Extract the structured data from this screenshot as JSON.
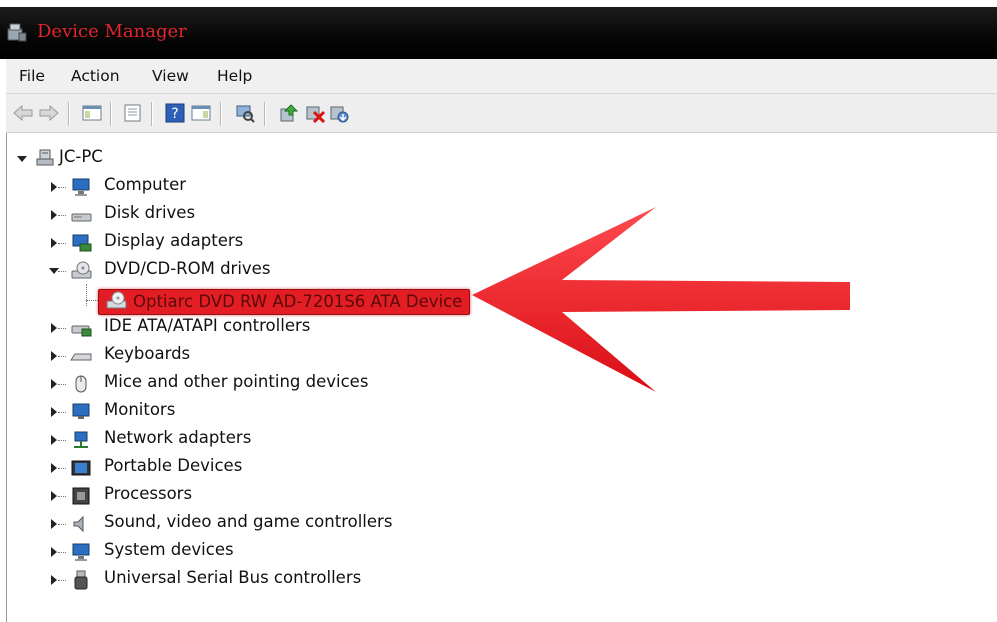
{
  "window": {
    "title": "Device Manager"
  },
  "menu": [
    "File",
    "Action",
    "View",
    "Help"
  ],
  "toolbar": {
    "buttons": [
      "back-icon",
      "forward-icon",
      "show-hide-console-tree-icon",
      "properties-icon",
      "help-icon",
      "action-pane-icon",
      "scan-hardware-icon",
      "update-driver-icon",
      "uninstall-icon",
      "disable-device-icon"
    ]
  },
  "tree": {
    "root": "JC-PC",
    "categories": [
      {
        "label": "Computer",
        "icon": "computer-icon",
        "expanded": false
      },
      {
        "label": "Disk drives",
        "icon": "disk-drive-icon",
        "expanded": false
      },
      {
        "label": "Display adapters",
        "icon": "display-adapter-icon",
        "expanded": false
      },
      {
        "label": "DVD/CD-ROM drives",
        "icon": "dvd-drive-icon",
        "expanded": true
      },
      {
        "label": "IDE ATA/ATAPI controllers",
        "icon": "ide-controller-icon",
        "expanded": false
      },
      {
        "label": "Keyboards",
        "icon": "keyboard-icon",
        "expanded": false
      },
      {
        "label": "Mice and other pointing devices",
        "icon": "mouse-icon",
        "expanded": false
      },
      {
        "label": "Monitors",
        "icon": "monitor-icon",
        "expanded": false
      },
      {
        "label": "Network adapters",
        "icon": "network-adapter-icon",
        "expanded": false
      },
      {
        "label": "Portable Devices",
        "icon": "portable-device-icon",
        "expanded": false
      },
      {
        "label": "Processors",
        "icon": "processor-icon",
        "expanded": false
      },
      {
        "label": "Sound, video and game controllers",
        "icon": "sound-icon",
        "expanded": false
      },
      {
        "label": "System devices",
        "icon": "system-devices-icon",
        "expanded": false
      },
      {
        "label": "Universal Serial Bus controllers",
        "icon": "usb-icon",
        "expanded": false
      }
    ],
    "selected_device": "Optiarc DVD RW AD-7201S6 ATA Device"
  },
  "colors": {
    "title": "#e2262b",
    "highlight": "#e31d24",
    "arrow": "#e8141b"
  }
}
